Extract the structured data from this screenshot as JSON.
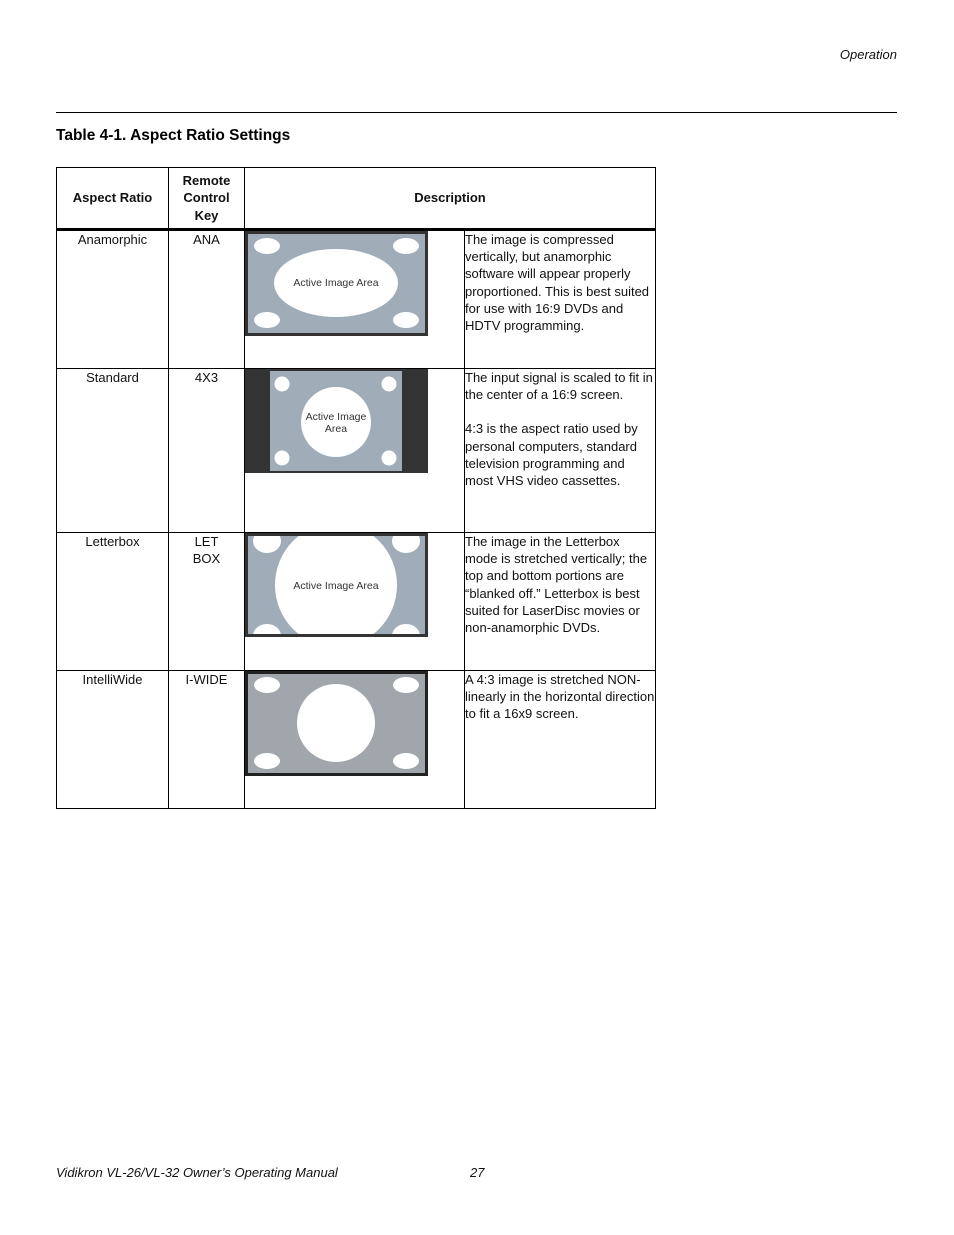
{
  "header": {
    "section": "Operation"
  },
  "table": {
    "title": "Table 4-1. Aspect Ratio Settings",
    "columns": {
      "aspect_ratio": "Aspect Ratio",
      "remote_key": "Remote Control Key",
      "description": "Description"
    },
    "rows": [
      {
        "name": "Anamorphic",
        "key": "ANA",
        "diagram_label": "Active Image Area",
        "description": [
          "The image is compressed vertically, but anamorphic software will appear properly proportioned. This is best suited for use with 16:9 DVDs and HDTV programming."
        ]
      },
      {
        "name": "Standard",
        "key": "4X3",
        "diagram_label_line1": "Active Image",
        "diagram_label_line2": "Area",
        "description": [
          "The input signal is scaled to fit in the center of a 16:9 screen.",
          "4:3 is the aspect ratio used by personal computers, standard television programming and most VHS video cassettes."
        ]
      },
      {
        "name": "Letterbox",
        "key": "LET\nBOX",
        "diagram_label": "Active Image Area",
        "description": [
          "The image in the Letterbox mode is stretched vertically; the top and bottom portions are “blanked off.” Letterbox is best suited for LaserDisc movies or non-anamorphic DVDs."
        ]
      },
      {
        "name": "IntelliWide",
        "key": "I-WIDE",
        "description": [
          "A 4:3 image is stretched NON-linearly in the horizontal direction to fit a 16x9 screen."
        ]
      }
    ]
  },
  "colors": {
    "screen_blue_gray": "#a0adb9",
    "screen_gray": "#a1a6ac",
    "frame_dark": "#333333",
    "active_area": "#ffffff"
  },
  "footer": {
    "manual_title": "Vidikron VL-26/VL-32 Owner’s Operating Manual",
    "page_number": "27"
  }
}
